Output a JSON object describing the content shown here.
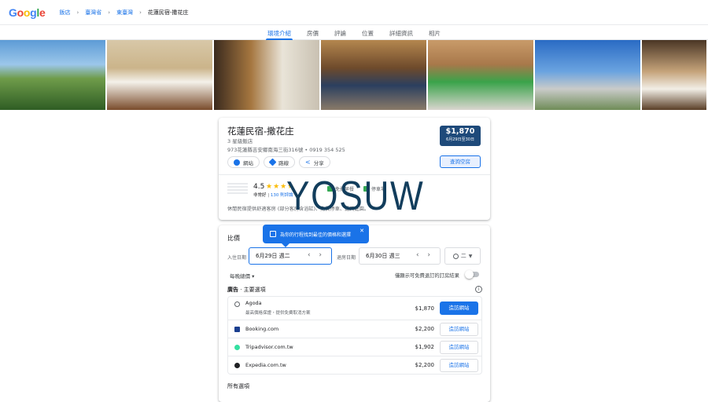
{
  "header": {
    "logo": "Google",
    "breadcrumbs": [
      "飯店",
      "臺灣省",
      "東臺灣"
    ],
    "current": "花蓮民宿-撒花庄"
  },
  "tabs": [
    "環境介紹",
    "房價",
    "評論",
    "位置",
    "詳細資訊",
    "相片"
  ],
  "active_tab": "環境介紹",
  "hotel": {
    "name": "花蓮民宿-撒花庄",
    "class": "3 星級飯店",
    "address_phone": "973花蓮縣吉安鄉南海三街316號 • 0919 354 525",
    "actions": [
      "網站",
      "路線",
      "分享"
    ],
    "price": "$1,870",
    "price_dates": "6月29日至30日",
    "check_availability": "查詢空房",
    "rating": "4.5",
    "rating_label": "非常好",
    "reviews": "130 則評論",
    "amenity_1": "免費早餐",
    "amenity_2": "停車場",
    "description": "休閒民宿提供舒適客房 (部分客房含浴缸)、免費停車、露天庭園。",
    "watermark": "YOSUW"
  },
  "prices": {
    "title": "比價",
    "tooltip": "為你的行程找到最佳的價格和選擇",
    "checkin_label": "入住日期",
    "checkin": "6月29日 週二",
    "checkout_label": "退房日期",
    "checkout": "6月30日 週三",
    "guests": "二",
    "nightly": "每晚總價 ▾",
    "free_cancel": "僅顯示可免費退訂的訂房結果",
    "ads_prefix": "廣告",
    "ads_title": " · 主要選項",
    "offers": [
      {
        "name": "Agoda",
        "sub": "最高價格保證・提供免費取消方案",
        "price": "$1,870",
        "btn": "造訪網站"
      },
      {
        "name": "Booking.com",
        "sub": "",
        "price": "$2,200",
        "btn": "造訪網站"
      },
      {
        "name": "Tripadvisor.com.tw",
        "sub": "",
        "price": "$1,902",
        "btn": "造訪網站"
      },
      {
        "name": "Expedia.com.tw",
        "sub": "",
        "price": "$2,200",
        "btn": "造訪網站"
      }
    ],
    "all_options": "所有選項"
  },
  "colors": {
    "accent": "#1a73e8",
    "price_box": "#1e4a7a",
    "watermark": "#123d5c"
  }
}
